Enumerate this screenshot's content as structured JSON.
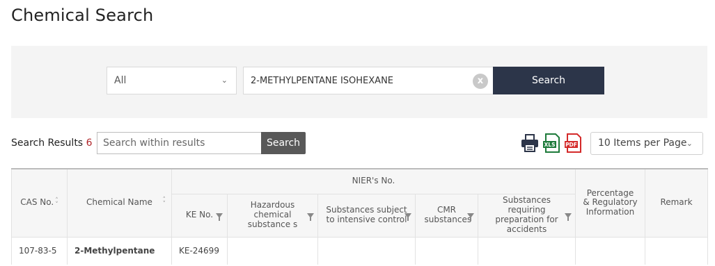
{
  "page": {
    "title": "Chemical Search"
  },
  "search": {
    "scope_value": "All",
    "keyword_value": "2-METHYLPENTANE ISOHEXANE",
    "clear_label": "x",
    "button_label": "Search"
  },
  "results_bar": {
    "label": "Search Results",
    "count": "6",
    "within_placeholder": "Search within results",
    "within_button_label": "Search",
    "export_icons": [
      "print-icon",
      "xls-icon",
      "pdf-icon"
    ],
    "xls_label": "XLS",
    "pdf_label": "PDF",
    "per_page_value": "10 Items per Page"
  },
  "table": {
    "headers": {
      "cas_no": "CAS No.",
      "chemical_name": "Chemical Name",
      "nier_group": "NIER's No.",
      "ke_no": "KE No.",
      "hazardous": "Hazardous chemical substance s",
      "intensive": "Substances subject to intensive control",
      "cmr": "CMR substances",
      "accidents": "Substances requiring preparation for accidents",
      "percentage": "Percentage & Regulatory Information",
      "remark": "Remark"
    },
    "rows": [
      {
        "cas_no": "107-83-5",
        "chemical_name": "2-Methylpentane",
        "ke_no": "KE-24699",
        "hazardous": "",
        "intensive": "",
        "cmr": "",
        "accidents": "",
        "percentage": "",
        "remark": ""
      }
    ]
  },
  "colors": {
    "primary_button": "#2c3549",
    "secondary_button": "#595959",
    "count_accent": "#b0262b",
    "xls_green": "#1d7a3a",
    "pdf_red": "#d42a2a"
  }
}
